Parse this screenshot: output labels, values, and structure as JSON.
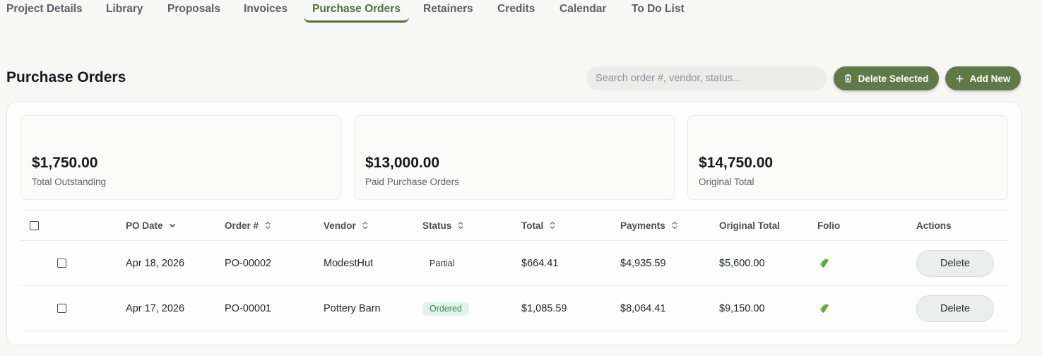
{
  "tabs": [
    {
      "label": "Project Details"
    },
    {
      "label": "Library"
    },
    {
      "label": "Proposals"
    },
    {
      "label": "Invoices"
    },
    {
      "label": "Purchase Orders",
      "active": true
    },
    {
      "label": "Retainers"
    },
    {
      "label": "Credits"
    },
    {
      "label": "Calendar"
    },
    {
      "label": "To Do List"
    }
  ],
  "header": {
    "title": "Purchase Orders",
    "search_placeholder": "Search order #, vendor, status...",
    "delete_selected_label": "Delete Selected",
    "add_new_label": "Add New"
  },
  "stats": [
    {
      "value": "$1,750.00",
      "label": "Total Outstanding"
    },
    {
      "value": "$13,000.00",
      "label": "Paid Purchase Orders"
    },
    {
      "value": "$14,750.00",
      "label": "Original Total"
    }
  ],
  "table": {
    "columns": [
      "PO Date",
      "Order #",
      "Vendor",
      "Status",
      "Total",
      "Payments",
      "Original Total",
      "Folio",
      "Actions"
    ],
    "rows": [
      {
        "po_date": "Apr 18, 2026",
        "order": "PO-00002",
        "vendor": "ModestHut",
        "status": "Partial",
        "total": "$664.41",
        "payments": "$4,935.59",
        "original_total": "$5,600.00",
        "action": "Delete"
      },
      {
        "po_date": "Apr 17, 2026",
        "order": "PO-00001",
        "vendor": "Pottery Barn",
        "status": "Ordered",
        "total": "$1,085.59",
        "payments": "$8,064.41",
        "original_total": "$9,150.00",
        "action": "Delete"
      }
    ]
  },
  "colors": {
    "accent": "#5f7a48",
    "active_tab": "#546f3d",
    "ordered_badge_text": "#2e8a5c",
    "ordered_badge_bg": "#e2f3ea",
    "folio_icon": "#7cc35a"
  },
  "icons": {
    "delete_selected": "trash-icon",
    "add_new": "plus-icon",
    "sort_desc": "chevron-down-icon",
    "sortable": "sort-updown-icon",
    "folio": "folio-leaf-icon"
  }
}
